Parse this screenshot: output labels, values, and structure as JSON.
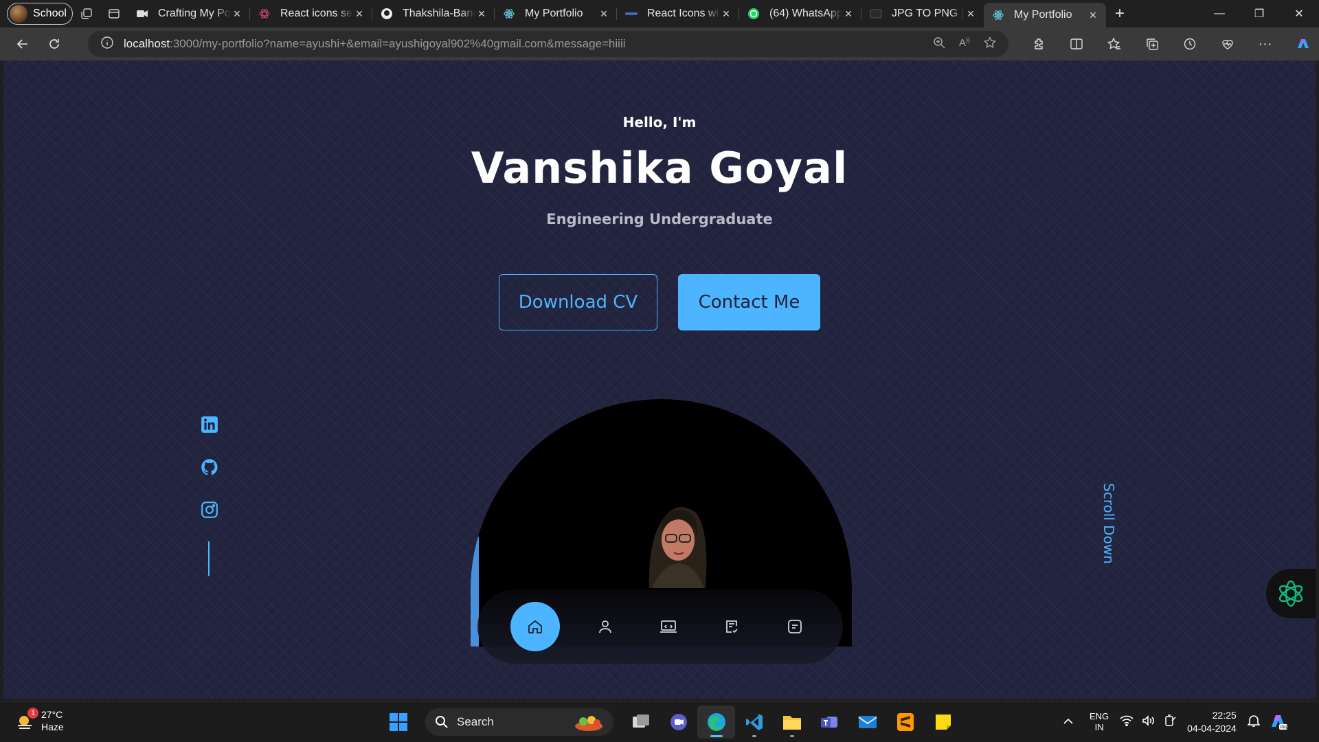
{
  "browser": {
    "profile_label": "School",
    "tabs": [
      {
        "title": "Crafting My Po",
        "icon": "video-icon"
      },
      {
        "title": "React icons sea",
        "icon": "react-icons-icon"
      },
      {
        "title": "Thakshila-Band",
        "icon": "github-icon"
      },
      {
        "title": "My Portfolio",
        "icon": "react-icon"
      },
      {
        "title": "React Icons wi",
        "icon": "tab-icon"
      },
      {
        "title": "(64) WhatsApp",
        "icon": "whatsapp-icon"
      },
      {
        "title": "JPG TO PNG | F",
        "icon": "tab-icon"
      },
      {
        "title": "My Portfolio",
        "icon": "react-icon",
        "active": true
      }
    ],
    "url_host": "localhost",
    "url_rest": ":3000/my-portfolio?name=ayushi+&email=ayushigoyal902%40gmail.com&message=hiiii"
  },
  "hero": {
    "greeting": "Hello, I'm",
    "name": "Vanshika Goyal",
    "role": "Engineering Undergraduate",
    "download_label": "Download CV",
    "contact_label": "Contact Me",
    "scroll_label": "Scroll Down"
  },
  "social": [
    "linkedin-icon",
    "github-icon",
    "instagram-icon"
  ],
  "bottom_nav": [
    "home-icon",
    "user-icon",
    "experience-icon",
    "services-icon",
    "contact-icon"
  ],
  "colors": {
    "accent": "#4db5ff",
    "background": "#23243f"
  },
  "taskbar": {
    "weather_temp": "27°C",
    "weather_desc": "Haze",
    "notification_count": "1",
    "search_label": "Search",
    "lang_top": "ENG",
    "lang_bottom": "IN",
    "time": "22:25",
    "date": "04-04-2024"
  }
}
